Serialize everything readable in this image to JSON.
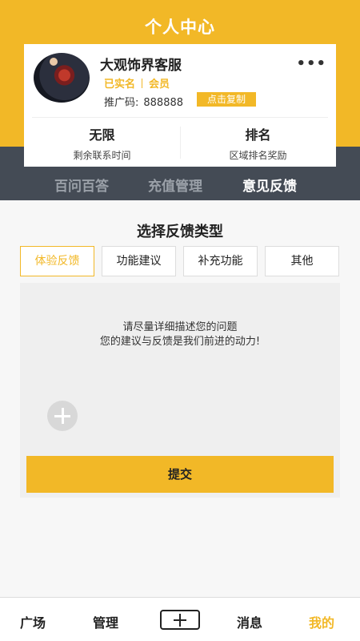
{
  "header": {
    "title": "个人中心"
  },
  "profile": {
    "name": "大观饰界客服",
    "tags": [
      "已实名",
      "会员"
    ],
    "promo_label": "推广码:",
    "promo_code": "888888",
    "copy_label": "点击复制",
    "more_icon": "more-dots-icon",
    "stats": [
      {
        "value": "无限",
        "label": "剩余联系时间"
      },
      {
        "value": "排名",
        "label": "区域排名奖励"
      }
    ]
  },
  "tabs": [
    "百问百答",
    "充值管理",
    "意见反馈"
  ],
  "active_tab": "意见反馈",
  "feedback": {
    "title": "选择反馈类型",
    "types": [
      "体验反馈",
      "功能建议",
      "补充功能",
      "其他"
    ],
    "selected_type": "体验反馈",
    "hint_lines": [
      "请尽量详细描述您的问题",
      "您的建议与反馈是我们前进的动力!"
    ],
    "add_icon": "add-photo-icon",
    "submit_label": "提交"
  },
  "nav": {
    "items": [
      "广场",
      "管理",
      "消息",
      "我的"
    ],
    "add_icon": "plus-icon",
    "active": "我的"
  },
  "colors": {
    "accent": "#f2b827",
    "dark": "#444b55"
  }
}
